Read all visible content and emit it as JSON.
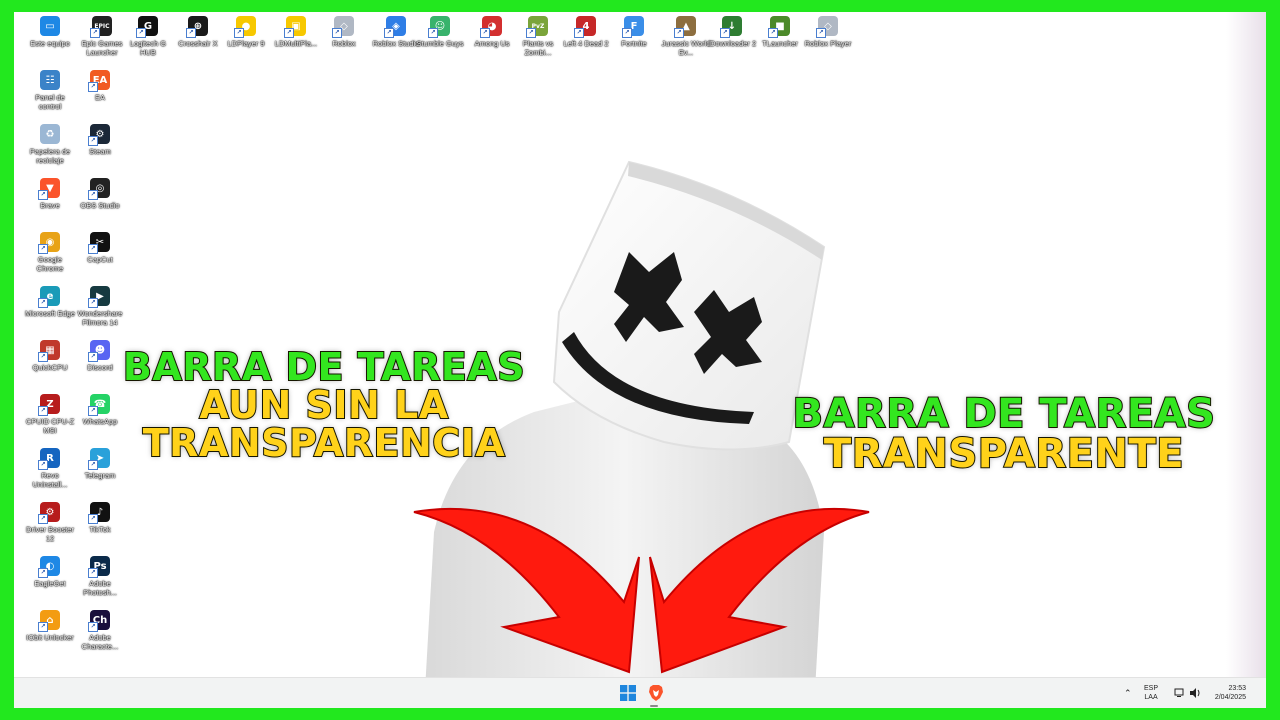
{
  "desktop": {
    "icons": [
      {
        "label": "Este equipo",
        "icon": "computer-icon",
        "color": "#1e88e5",
        "glyph": "▭"
      },
      {
        "label": "Epic Games Launcher",
        "icon": "epic-games-icon",
        "color": "#222222",
        "glyph": "EPIC"
      },
      {
        "label": "Logitech G HUB",
        "icon": "logitech-icon",
        "color": "#111111",
        "glyph": "G"
      },
      {
        "label": "Crosshair X",
        "icon": "crosshair-icon",
        "color": "#1a1a1a",
        "glyph": "⊕"
      },
      {
        "label": "LDPlayer 9",
        "icon": "ldplayer-icon",
        "color": "#f7c800",
        "glyph": "●"
      },
      {
        "label": "LDMultiPla...",
        "icon": "ldmultiplayer-icon",
        "color": "#f7c800",
        "glyph": "▣"
      },
      {
        "label": "Roblox",
        "icon": "roblox-icon",
        "color": "#b0b8c4",
        "glyph": "◇"
      },
      {
        "label": "Roblox Studio",
        "icon": "roblox-studio-icon",
        "color": "#2f7ee6",
        "glyph": "◈"
      },
      {
        "label": "Stumble Guys",
        "icon": "stumble-guys-icon",
        "color": "#38b36c",
        "glyph": "☺"
      },
      {
        "label": "Among Us",
        "icon": "among-us-icon",
        "color": "#d32f2f",
        "glyph": "◕"
      },
      {
        "label": "Plants vs Zombi...",
        "icon": "plants-vs-zombies-icon",
        "color": "#7aa43a",
        "glyph": "PvZ"
      },
      {
        "label": "Left 4 Dead 2",
        "icon": "left4dead-icon",
        "color": "#c62828",
        "glyph": "4"
      },
      {
        "label": "Fortnite",
        "icon": "fortnite-icon",
        "color": "#3a8ee8",
        "glyph": "F"
      },
      {
        "label": "Jurassic World Ev...",
        "icon": "jurassic-world-icon",
        "color": "#8d6e3f",
        "glyph": "▲"
      },
      {
        "label": "IDownloader 2",
        "icon": "idownloader-icon",
        "color": "#2e7d32",
        "glyph": "↓"
      },
      {
        "label": "TLauncher",
        "icon": "tlauncher-icon",
        "color": "#4c8a2a",
        "glyph": "■"
      },
      {
        "label": "Roblox Player",
        "icon": "roblox-player-icon",
        "color": "#b0b8c4",
        "glyph": "◇"
      },
      {
        "label": "Panel de control",
        "icon": "control-panel-icon",
        "color": "#3b83c8",
        "glyph": "☷"
      },
      {
        "label": "EA",
        "icon": "ea-icon",
        "color": "#f15a22",
        "glyph": "EA"
      },
      {
        "label": "Papelera de reciclaje",
        "icon": "recycle-bin-icon",
        "color": "#9bb7d4",
        "glyph": "♻"
      },
      {
        "label": "Steam",
        "icon": "steam-icon",
        "color": "#1b2838",
        "glyph": "⚙"
      },
      {
        "label": "Brave",
        "icon": "brave-icon",
        "color": "#fb542b",
        "glyph": "▼"
      },
      {
        "label": "OBS Studio",
        "icon": "obs-icon",
        "color": "#222222",
        "glyph": "◎"
      },
      {
        "label": "Google Chrome",
        "icon": "chrome-icon",
        "color": "#e8a317",
        "glyph": "◉"
      },
      {
        "label": "CapCut",
        "icon": "capcut-icon",
        "color": "#111111",
        "glyph": "✂"
      },
      {
        "label": "Microsoft Edge",
        "icon": "edge-icon",
        "color": "#1a9bb8",
        "glyph": "e"
      },
      {
        "label": "Wondershare Filmora 14",
        "icon": "filmora-icon",
        "color": "#163a40",
        "glyph": "▶"
      },
      {
        "label": "QuickCPU",
        "icon": "quickcpu-icon",
        "color": "#c0392b",
        "glyph": "▦"
      },
      {
        "label": "Discord",
        "icon": "discord-icon",
        "color": "#5865f2",
        "glyph": "☻"
      },
      {
        "label": "CPUID CPU-Z MSI",
        "icon": "cpuz-icon",
        "color": "#b71c1c",
        "glyph": "Z"
      },
      {
        "label": "WhatsApp",
        "icon": "whatsapp-icon",
        "color": "#25d366",
        "glyph": "☎"
      },
      {
        "label": "Revo Uninstall...",
        "icon": "revo-uninstaller-icon",
        "color": "#1565c0",
        "glyph": "R"
      },
      {
        "label": "Telegram",
        "icon": "telegram-icon",
        "color": "#2aa1da",
        "glyph": "➤"
      },
      {
        "label": "Driver Booster 12",
        "icon": "driver-booster-icon",
        "color": "#b71c1c",
        "glyph": "⚙"
      },
      {
        "label": "TikTok",
        "icon": "tiktok-icon",
        "color": "#111111",
        "glyph": "♪"
      },
      {
        "label": "EagleGet",
        "icon": "eagleget-icon",
        "color": "#1e88e5",
        "glyph": "◐"
      },
      {
        "label": "Adobe Photosh...",
        "icon": "photoshop-icon",
        "color": "#0b2a4a",
        "glyph": "Ps"
      },
      {
        "label": "IObit Unlocker",
        "icon": "iobit-unlocker-icon",
        "color": "#f39c12",
        "glyph": "⌂"
      },
      {
        "label": "Adobe Characte...",
        "icon": "character-animator-icon",
        "color": "#1a0f3c",
        "glyph": "Ch"
      }
    ]
  },
  "captions": {
    "left": [
      "BARRA DE TAREAS",
      "AUN SIN LA",
      "TRANSPARENCIA"
    ],
    "right": [
      "BARRA DE TAREAS",
      "TRANSPARENTE"
    ]
  },
  "taskbar": {
    "start_icon": "windows-start-icon",
    "pinned_icon": "brave-icon",
    "language_line1": "ESP",
    "language_line2": "LAA",
    "time": "23:53",
    "date": "2/04/2025"
  },
  "colors": {
    "border_green": "#22e81e",
    "caption_green": "#33e61f",
    "caption_yellow": "#ffd21a",
    "arrow_red": "#ff1a0e"
  }
}
